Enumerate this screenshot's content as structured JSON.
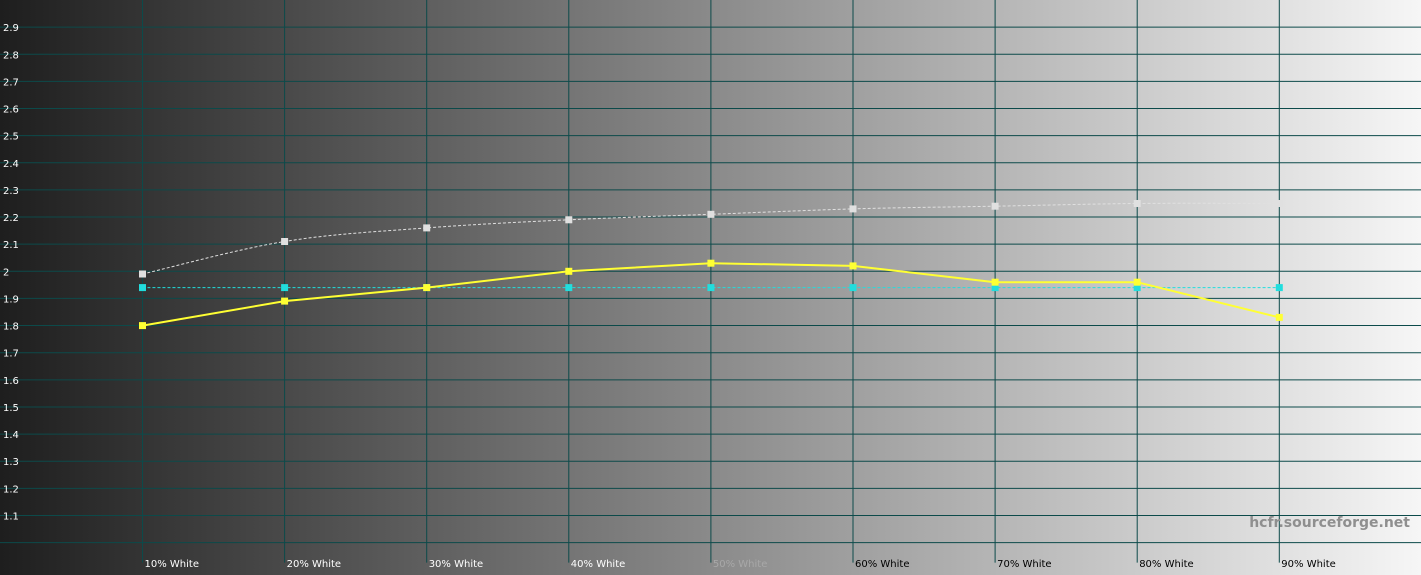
{
  "chart_data": {
    "type": "line",
    "categories": [
      "10% White",
      "20% White",
      "30% White",
      "40% White",
      "50% White",
      "60% White",
      "70% White",
      "80% White",
      "90% White"
    ],
    "ylim": [
      1.0,
      3.0
    ],
    "yticks": [
      "1.1",
      "1.2",
      "1.3",
      "1.4",
      "1.5",
      "1.6",
      "1.7",
      "1.8",
      "1.9",
      "2",
      "2.1",
      "2.2",
      "2.3",
      "2.4",
      "2.5",
      "2.6",
      "2.7",
      "2.8",
      "2.9"
    ],
    "grid": true,
    "series": [
      {
        "color": "#ffff33",
        "style": "solid",
        "values": [
          1.8,
          1.89,
          1.94,
          2.0,
          2.03,
          2.02,
          1.96,
          1.96,
          1.83
        ]
      },
      {
        "color": "#e0e0e0",
        "style": "dashed",
        "values": [
          1.99,
          2.11,
          2.16,
          2.19,
          2.21,
          2.23,
          2.24,
          2.25,
          2.25
        ]
      },
      {
        "color": "#22dddd",
        "style": "dashed",
        "values": [
          1.94,
          1.94,
          1.94,
          1.94,
          1.94,
          1.94,
          1.94,
          1.94,
          1.94
        ]
      }
    ],
    "gradient": {
      "start": "#1e1e1e",
      "end": "#f6f6f6"
    },
    "grid_color": "#0c4a4a"
  },
  "watermark": "hcfr.sourceforge.net"
}
